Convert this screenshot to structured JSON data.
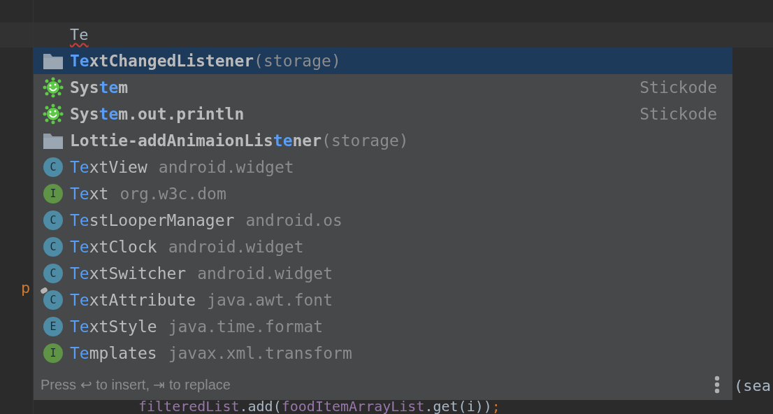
{
  "editor": {
    "typed_text": "Te",
    "fragments": [
      {
        "kind": "keyword",
        "text": "p"
      },
      {
        "kind": "call",
        "text": "(sea"
      }
    ],
    "bottom_line": [
      {
        "kind": "field",
        "text": "filteredList"
      },
      {
        "kind": "plain",
        "text": ".add("
      },
      {
        "kind": "field",
        "text": "foodItemArrayList"
      },
      {
        "kind": "plain",
        "text": ".get(i))"
      },
      {
        "kind": "punct",
        "text": ";"
      }
    ]
  },
  "popup": {
    "items": [
      {
        "kind": "folder",
        "selected": true,
        "pinned": false,
        "name_parts": [
          {
            "text": "Te",
            "match": true
          },
          {
            "text": "xtChangedListener",
            "match": false
          }
        ],
        "detail": "(storage)"
      },
      {
        "kind": "plugin",
        "selected": false,
        "pinned": false,
        "name_parts": [
          {
            "text": "Sys",
            "match": false
          },
          {
            "text": "te",
            "match": true
          },
          {
            "text": "m",
            "match": false
          }
        ],
        "type_text": "Stickode"
      },
      {
        "kind": "plugin",
        "selected": false,
        "pinned": false,
        "name_parts": [
          {
            "text": "Sys",
            "match": false
          },
          {
            "text": "te",
            "match": true
          },
          {
            "text": "m.out.println",
            "match": false
          }
        ],
        "type_text": "Stickode"
      },
      {
        "kind": "folder",
        "selected": false,
        "pinned": false,
        "name_parts": [
          {
            "text": "Lottie-addAnimaionLis",
            "match": false
          },
          {
            "text": "te",
            "match": true
          },
          {
            "text": "ner",
            "match": false
          }
        ],
        "detail": "(storage)"
      },
      {
        "kind": "class",
        "icon_letter": "C",
        "selected": false,
        "pinned": false,
        "name_parts": [
          {
            "text": "Te",
            "match": true
          },
          {
            "text": "xtView",
            "match": false
          }
        ],
        "detail": "android.widget"
      },
      {
        "kind": "interface",
        "icon_letter": "I",
        "selected": false,
        "pinned": false,
        "name_parts": [
          {
            "text": "Te",
            "match": true
          },
          {
            "text": "xt",
            "match": false
          }
        ],
        "detail": "org.w3c.dom"
      },
      {
        "kind": "class",
        "icon_letter": "C",
        "selected": false,
        "pinned": false,
        "name_parts": [
          {
            "text": "Te",
            "match": true
          },
          {
            "text": "stLooperManager",
            "match": false
          }
        ],
        "detail": "android.os"
      },
      {
        "kind": "class",
        "icon_letter": "C",
        "selected": false,
        "pinned": false,
        "name_parts": [
          {
            "text": "Te",
            "match": true
          },
          {
            "text": "xtClock",
            "match": false
          }
        ],
        "detail": "android.widget"
      },
      {
        "kind": "class",
        "icon_letter": "C",
        "selected": false,
        "pinned": false,
        "name_parts": [
          {
            "text": "Te",
            "match": true
          },
          {
            "text": "xtSwitcher",
            "match": false
          }
        ],
        "detail": "android.widget"
      },
      {
        "kind": "class",
        "icon_letter": "C",
        "selected": false,
        "pinned": true,
        "name_parts": [
          {
            "text": "Te",
            "match": true
          },
          {
            "text": "xtAttribute",
            "match": false
          }
        ],
        "detail": "java.awt.font"
      },
      {
        "kind": "enum",
        "icon_letter": "E",
        "selected": false,
        "pinned": false,
        "name_parts": [
          {
            "text": "Te",
            "match": true
          },
          {
            "text": "xtStyle",
            "match": false
          }
        ],
        "detail": "java.time.format"
      },
      {
        "kind": "interface",
        "icon_letter": "I",
        "selected": false,
        "pinned": false,
        "name_parts": [
          {
            "text": "Te",
            "match": true
          },
          {
            "text": "mplates",
            "match": false
          }
        ],
        "detail": "javax.xml.transform"
      }
    ],
    "hint": "Press ↩ to insert, ⇥ to replace"
  }
}
